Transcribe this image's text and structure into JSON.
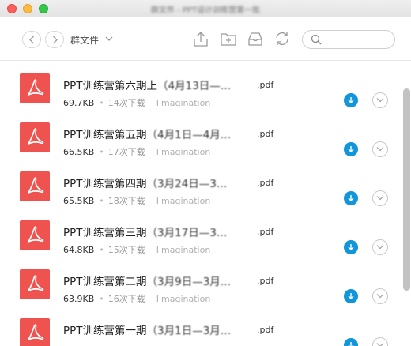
{
  "window": {
    "title": "群文件 - PPT设计训练营第一批"
  },
  "toolbar": {
    "back_icon": "chevron-left-icon",
    "forward_icon": "chevron-right-icon",
    "folder_title": "群文件",
    "upload_icon": "upload-icon",
    "new_folder_icon": "new-folder-icon",
    "inbox_icon": "inbox-icon",
    "refresh_icon": "refresh-icon",
    "search_placeholder": ""
  },
  "files": [
    {
      "prefix": "PPT训练营第六期上",
      "detail": "（4月13日—…",
      "ext": ".pdf",
      "size": "69.7KB",
      "downloads": "14次下载",
      "uploader": "I'magination"
    },
    {
      "prefix": "PPT训练营第五期",
      "detail": "（4月1日—4月…",
      "ext": ".pdf",
      "size": "66.5KB",
      "downloads": "17次下载",
      "uploader": "I'magination"
    },
    {
      "prefix": "PPT训练营第四期",
      "detail": "（3月24日—3…",
      "ext": ".pdf",
      "size": "65.5KB",
      "downloads": "18次下载",
      "uploader": "I'magination"
    },
    {
      "prefix": "PPT训练营第三期",
      "detail": "（3月17日—3…",
      "ext": ".pdf",
      "size": "64.8KB",
      "downloads": "15次下载",
      "uploader": "I'magination"
    },
    {
      "prefix": "PPT训练营第二期",
      "detail": "（3月9日—3月…",
      "ext": ".pdf",
      "size": "63.9KB",
      "downloads": "16次下载",
      "uploader": "I'magination"
    },
    {
      "prefix": "PPT训练营第一期",
      "detail": "（3月1日—3月…",
      "ext": ".pdf",
      "size": "",
      "downloads": "",
      "uploader": ""
    }
  ],
  "colors": {
    "pdf_icon": "#ef5350",
    "download_button": "#1296db",
    "close": "#fc605c",
    "minimize": "#fdbc40",
    "maximize": "#34c84a"
  }
}
